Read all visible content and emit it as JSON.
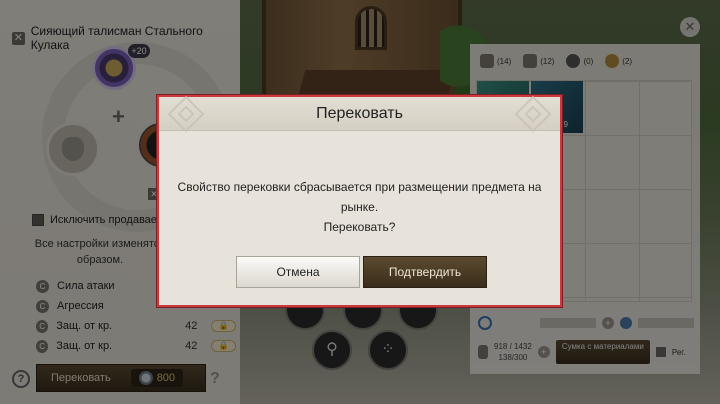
{
  "craft_panel": {
    "item_title": "Сияющий талисман Стального Кулака",
    "enhance_badge": "+20",
    "exclude_label": "Исключить продаваемые",
    "settings_note": "Все настройки изменятся образом.",
    "stats": [
      {
        "name": "Сила атаки",
        "value": ""
      },
      {
        "name": "Агрессия",
        "value": ""
      },
      {
        "name": "Защ. от кр.",
        "value": "42"
      },
      {
        "name": "Защ. от кр.",
        "value": "42"
      }
    ],
    "reforge_button": "Перековать",
    "reforge_cost": "800",
    "help": "?"
  },
  "inventory": {
    "tabs": [
      {
        "count": "(14)",
        "icon": "armor-icon"
      },
      {
        "count": "(12)",
        "icon": "crossed-swords-icon"
      },
      {
        "count": "(0)",
        "icon": "orb-icon"
      },
      {
        "count": "(2)",
        "icon": "money-bag-icon"
      }
    ],
    "item_count": "99",
    "capacity": "918 / 1432",
    "sub_capacity": "138/300",
    "materials_button": "Сумка с материалами",
    "reg_label": "Рег."
  },
  "modal": {
    "title": "Перековать",
    "message_line1": "Свойство перековки сбрасывается при размещении предмета на рынке.",
    "message_line2": "Перековать?",
    "cancel": "Отмена",
    "confirm": "Подтвердить"
  },
  "colors": {
    "modal_border": "#c9393e",
    "confirm_bg": "#4a3a24",
    "cost_gold": "#e0c36a"
  }
}
